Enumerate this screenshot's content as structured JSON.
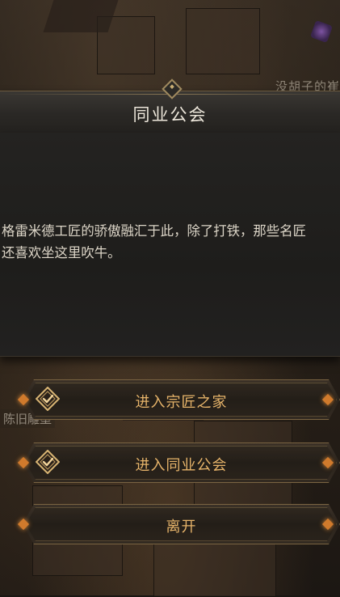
{
  "scene": {
    "npc_name_top": "没胡子的崔",
    "npc_name_mid": "陈旧雕塑"
  },
  "dialog": {
    "title": "同业公会",
    "text_line1": "格雷米德工匠的骄傲融汇于此，除了打铁，那些名匠",
    "text_line2": "还喜欢坐这里吹牛。"
  },
  "options": [
    {
      "label": "进入宗匠之家",
      "icon": "check-badge-icon"
    },
    {
      "label": "进入同业公会",
      "icon": "check-badge-icon"
    },
    {
      "label": "离开"
    }
  ],
  "colors": {
    "accent_gold": "#e7b46a",
    "accent_orange": "#d07a2c",
    "title_text": "#ece6da"
  }
}
